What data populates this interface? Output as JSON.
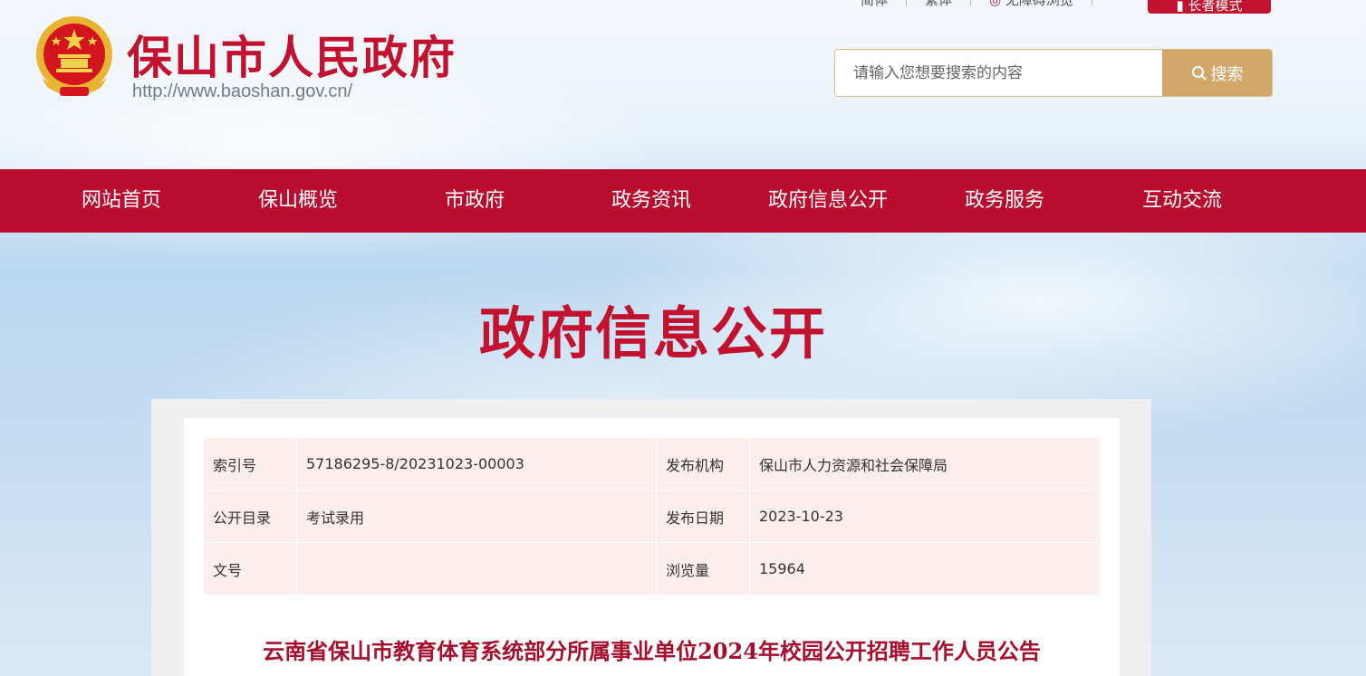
{
  "header": {
    "site_title": "保山市人民政府",
    "site_url": "http://www.baoshan.gov.cn/",
    "top_links": [
      "简体",
      "繁体",
      "无障碍浏览"
    ],
    "elder_mode_label": "长者模式",
    "search": {
      "placeholder": "请输入您想要搜索的内容",
      "button_label": "搜索"
    }
  },
  "nav": {
    "items": [
      "网站首页",
      "保山概览",
      "市政府",
      "政务资讯",
      "政府信息公开",
      "政务服务",
      "互动交流"
    ]
  },
  "section_title": "政府信息公开",
  "meta": {
    "index_label": "索引号",
    "index_value": "57186295-8/20231023-00003",
    "publisher_label": "发布机构",
    "publisher_value": "保山市人力资源和社会保障局",
    "catalog_label": "公开目录",
    "catalog_value": "考试录用",
    "date_label": "发布日期",
    "date_value": "2023-10-23",
    "docno_label": "文号",
    "docno_value": "",
    "views_label": "浏览量",
    "views_value": "15964"
  },
  "doc_title": "云南省保山市教育体育系统部分所属事业单位2024年校园公开招聘工作人员公告",
  "colors": {
    "brand_red": "#b90d30",
    "title_red": "#c3122f",
    "search_gold": "#d1a86a"
  }
}
